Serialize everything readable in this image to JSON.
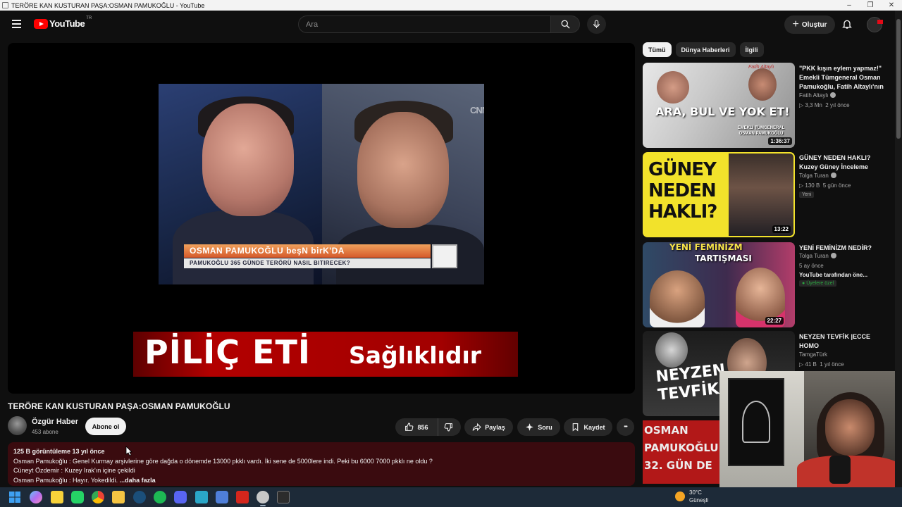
{
  "window": {
    "title": "TERÖRE KAN KUSTURAN PAŞA:OSMAN PAMUKOĞLU - YouTube",
    "minimize": "–",
    "maximize": "❐",
    "close": "✕"
  },
  "masthead": {
    "logo_text": "YouTube",
    "region": "TR",
    "search_placeholder": "Ara",
    "create_label": "Oluştur",
    "create_symbol": "+"
  },
  "player": {
    "lower_third_line1": "OSMAN PAMUKOĞLU beşN birK'DA",
    "lower_third_line2": "PAMUKOĞLU 365 GÜNDE TERÖRÜ NASIL BITIRECEK?",
    "cnn_watermark": "CNN",
    "banner_left": "PİLİÇ ETİ",
    "banner_right": "Sağlıklıdır"
  },
  "video": {
    "title": "TERÖRE KAN KUSTURAN PAŞA:OSMAN PAMUKOĞLU",
    "channel_name": "Özgür Haber",
    "subscribers": "453 abone",
    "subscribe_label": "Abone ol",
    "like_count": "856",
    "share_label": "Paylaş",
    "ask_label": "Soru",
    "save_label": "Kaydet",
    "more_label": "•••"
  },
  "description": {
    "meta": "125 B görüntüleme  13 yıl önce",
    "line1": "Osman Pamukoğlu : Genel Kurmay arşivlerine göre dağda o dönemde 13000 pkklı vardı. İki sene de 5000lere indi. Peki bu 6000 7000 pkklı ne oldu ?",
    "line2": "Cüneyt Özdemir : Kuzey Irak'ın içine çekildi",
    "line3": "Osman Pamukoğlu : Hayır. Yokedildi.",
    "more": "...daha fazla"
  },
  "sidebar": {
    "chips": [
      "Tümü",
      "Dünya Haberleri",
      "İlgili"
    ],
    "videos": [
      {
        "title": "\"PKK kışın eylem yapmaz!\" Emekli Tümgeneral Osman Pamukoğlu, Fatih Altaylı'nın ...",
        "channel": "Fatih Altaylı",
        "views": "3,3 Mn",
        "age": "2 yıl önce",
        "duration": "1:36:37",
        "thumb_text": "ARA, BUL VE YOK ET!",
        "thumb_sub": "EMEKLİ TÜMGENERAL OSMAN PAMUKOĞLU",
        "thumb_sig": "Fatih Altaylı"
      },
      {
        "title": "GÜNEY NEDEN HAKLI? Kuzey Güney İnceleme",
        "channel": "Tolga Turan",
        "views": "130 B",
        "age": "5 gün önce",
        "badge": "Yeni",
        "duration": "13:22",
        "thumb_text_1": "GÜNEY",
        "thumb_text_2": "NEDEN",
        "thumb_text_3": "HAKLI?"
      },
      {
        "title": "YENİ FEMİNİZM NEDİR?",
        "channel": "Tolga Turan",
        "age": "5 ay önce",
        "note": "YouTube tarafından öne...",
        "member": "Üyelere özel",
        "duration": "22:27",
        "thumb_text_1": "YENİ FEMİNİZM",
        "thumb_text_2": "TARTIŞMASI"
      },
      {
        "title": "NEYZEN TEVFİK |ECCE HOMO",
        "channel": "TamgaTürk",
        "views": "41 B",
        "age": "1 yıl önce",
        "thumb_text_1": "NEYZEN",
        "thumb_text_2": "TEVFİK"
      }
    ],
    "red_thumb_lines": [
      "OSMAN",
      "PAMUKOĞLU",
      "32. GÜN DE"
    ]
  },
  "taskbar": {
    "temperature": "30°C",
    "condition": "Güneşli"
  },
  "colors": {
    "youtube_red": "#ff0000",
    "description_bg": "#3a0b0f",
    "taskbar_bg": "#1d2a38"
  }
}
